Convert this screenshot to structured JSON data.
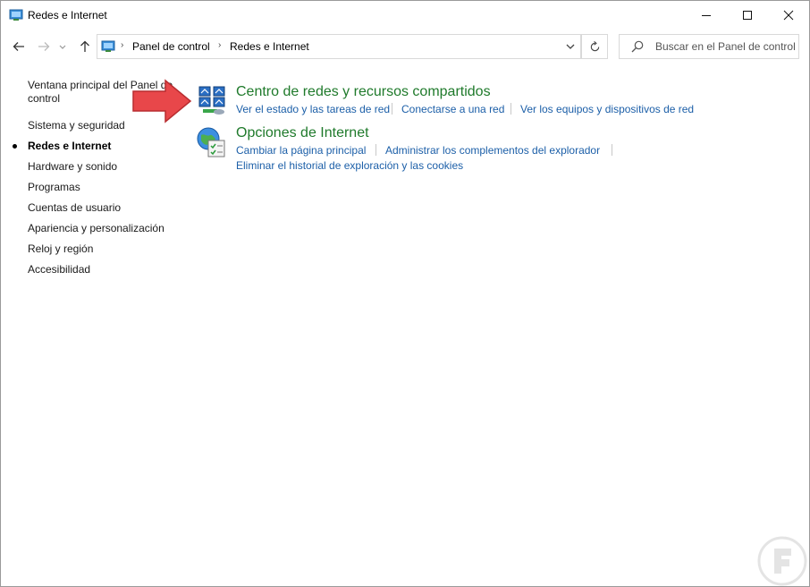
{
  "window": {
    "title": "Redes e Internet"
  },
  "address": {
    "crumbs": [
      "Panel de control",
      "Redes e Internet"
    ]
  },
  "search": {
    "placeholder": "Buscar en el Panel de control"
  },
  "sidebar": {
    "items": [
      {
        "label": "Ventana principal del Panel de control",
        "active": false
      },
      {
        "label": "Sistema y seguridad",
        "active": false
      },
      {
        "label": "Redes e Internet",
        "active": true
      },
      {
        "label": "Hardware y sonido",
        "active": false
      },
      {
        "label": "Programas",
        "active": false
      },
      {
        "label": "Cuentas de usuario",
        "active": false
      },
      {
        "label": "Apariencia y personalización",
        "active": false
      },
      {
        "label": "Reloj y región",
        "active": false
      },
      {
        "label": "Accesibilidad",
        "active": false
      }
    ]
  },
  "categories": [
    {
      "title": "Centro de redes y recursos compartidos",
      "icon": "network-sharing-center-icon",
      "tasks": [
        "Ver el estado y las tareas de red",
        "Conectarse a una red",
        "Ver los equipos y dispositivos de red"
      ]
    },
    {
      "title": "Opciones de Internet",
      "icon": "internet-options-icon",
      "tasks": [
        "Cambiar la página principal",
        "Administrar los complementos del explorador",
        "Eliminar el historial de exploración y las cookies"
      ]
    }
  ],
  "colors": {
    "category_title": "#1f7a2b",
    "link": "#1c5fa8",
    "annotation_arrow": "#e8474a"
  }
}
